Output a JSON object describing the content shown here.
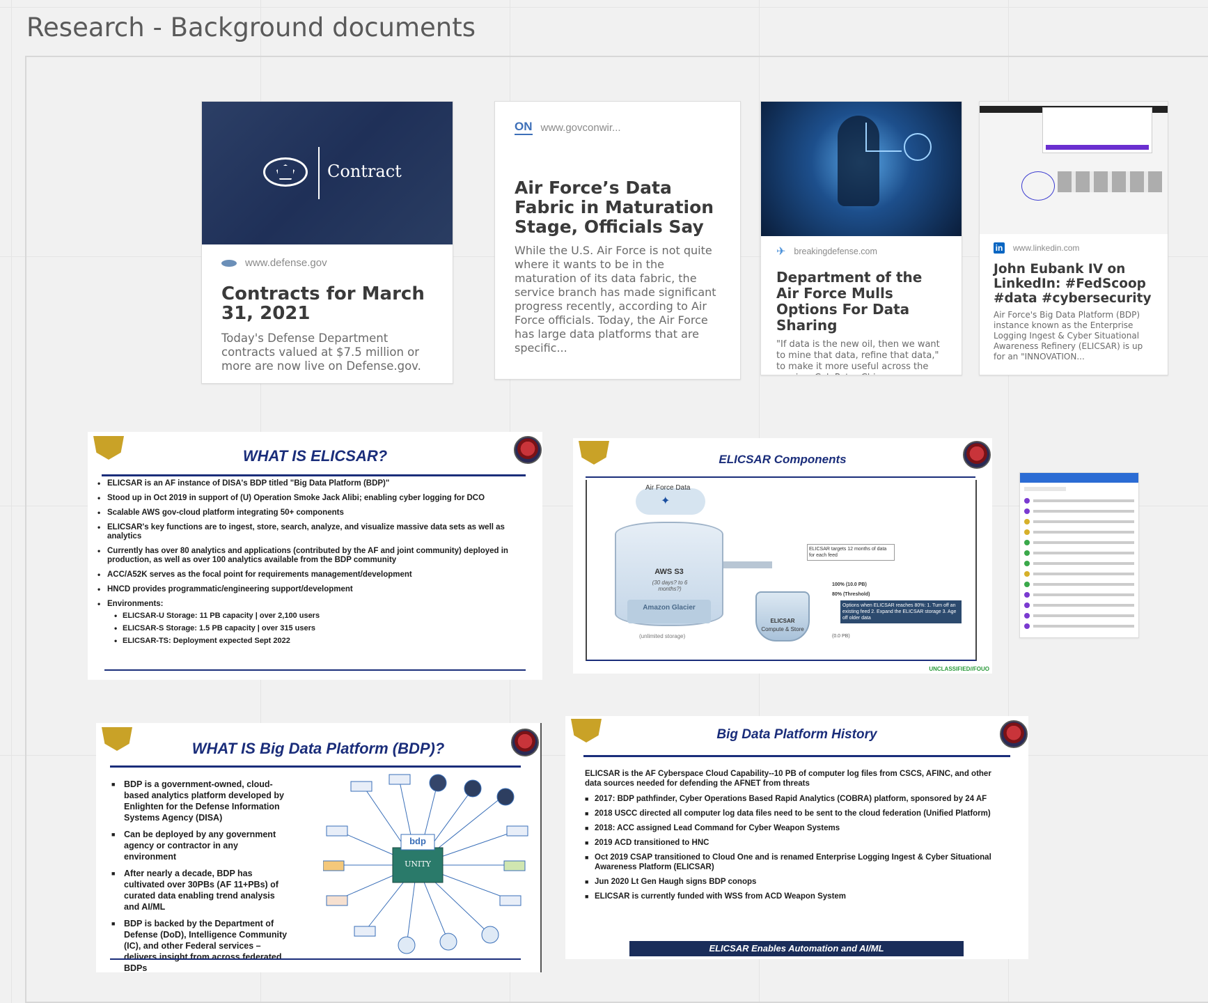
{
  "board": {
    "title": "Research - Background documents"
  },
  "cards": [
    {
      "banner_text": "Contract",
      "source": "www.defense.gov",
      "title": "Contracts for March 31, 2021",
      "description": "Today's Defense Department contracts valued at $7.5 million or more are now live on Defense.gov."
    },
    {
      "source_badge": "ON",
      "source": "www.govconwir...",
      "title": "Air Force’s Data Fabric in Maturation Stage, Officials Say",
      "description": "While the U.S. Air Force is not quite where it wants to be in the maturation of its data fabric, the service branch has made significant progress recently, according to Air Force officials. Today, the Air Force has large data platforms that are specific..."
    },
    {
      "source": "breakingdefense.com",
      "title": "Department of the Air Force Mulls Options For Data Sharing",
      "description": "\"If data is the new oil, then we want to mine that data, refine that data,\" to make it more useful across the service, Col. Peter Chiou says."
    },
    {
      "source_badge": "in",
      "source": "www.linkedin.com",
      "title": "John Eubank IV on LinkedIn: #FedScoop #data #cybersecurity",
      "description": "Air Force's Big Data Platform (BDP) instance known as the Enterprise Logging Ingest & Cyber Situational Awareness Refinery (ELICSAR) is up for an \"INNOVATION..."
    }
  ],
  "slides": {
    "elicsar": {
      "title": "WHAT IS ELICSAR?",
      "bullets": [
        "ELICSAR is an AF instance of DISA's BDP titled \"Big Data Platform (BDP)\"",
        "Stood up in Oct 2019 in support of (U) Operation Smoke Jack Alibi; enabling cyber logging for DCO",
        "Scalable AWS gov-cloud platform integrating 50+ components",
        "ELICSAR's key functions are to ingest, store, search, analyze, and visualize massive data sets as well as analytics",
        "Currently has over 80 analytics and applications (contributed by the AF and joint community) deployed in production, as well as over 100 analytics available from the BDP community",
        "ACC/A52K serves as the focal point for requirements management/development",
        "HNCD provides programmatic/engineering support/development",
        "Environments:"
      ],
      "sub_bullets": [
        "ELICSAR-U Storage: 11 PB capacity | over 2,100 users",
        "ELICSAR-S Storage: 1.5 PB capacity | over 315 users",
        "ELICSAR-TS: Deployment expected Sept 2022"
      ]
    },
    "components": {
      "title": "ELICSAR Components",
      "cloud_label": "Air Force Data",
      "tank_label": "AWS S3",
      "tank_sub": "(30 days? to 6 months?)",
      "glacier_label": "Amazon Glacier",
      "bucket_label": "ELICSAR",
      "bucket_sub": "Compute & Store",
      "callout_top": "ELICSAR targets 12 months of data for each feed",
      "level_100": "100% (10.0 PB)",
      "level_80": "80% (Threshold)",
      "level_0": "(0.0 PB)",
      "options_box": "Options when ELICSAR reaches 80%: 1. Turn off an existing feed 2. Expand the ELICSAR storage 3. Age off older data",
      "left_note": "(unlimited storage)",
      "classification": "UNCLASSIFIED//FOUO"
    },
    "bdp": {
      "title": "WHAT IS Big Data Platform (BDP)?",
      "bullets": [
        "BDP is a government-owned, cloud-based analytics platform developed by Enlighten for the Defense Information Systems Agency (DISA)",
        "Can be deployed by any government agency or contractor in any environment",
        "After nearly a decade, BDP has cultivated over 30PBs (AF 11+PBs) of curated data enabling trend analysis and AI/ML",
        "BDP is backed by the Department of Defense (DoD), Intelligence Community (IC), and other Federal services – delivers insight from across federated BDPs"
      ],
      "hub_top": "bdp",
      "hub_bottom": "UNITY"
    },
    "history": {
      "title": "Big Data Platform History",
      "intro": "ELICSAR is the AF Cyberspace Cloud Capability--10 PB of computer log files from CSCS, AFINC, and other data sources needed for defending the AFNET from threats",
      "bullets": [
        "2017: BDP pathfinder, Cyber Operations Based Rapid Analytics (COBRA) platform, sponsored by 24 AF",
        "2018 USCC directed all computer log data files need to be sent to the cloud federation (Unified Platform)",
        "2018: ACC assigned Lead Command for Cyber Weapon Systems",
        "2019 ACD transitioned to HNC",
        "Oct 2019 CSAP transitioned to Cloud One and is renamed Enterprise Logging Ingest & Cyber Situational Awareness Platform (ELICSAR)",
        "Jun 2020 Lt Gen Haugh signs BDP conops",
        "ELICSAR is currently funded with WSS from ACD Weapon System"
      ],
      "banner": "ELICSAR Enables Automation and AI/ML"
    }
  },
  "colors": {
    "slide_navy": "#1a2d7a",
    "card_title": "#3a3a3a",
    "linkedin": "#0a66c2",
    "classification_green": "#2a9a3a"
  }
}
